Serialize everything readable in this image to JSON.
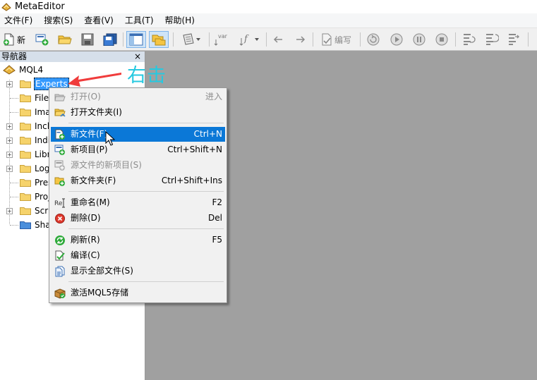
{
  "window": {
    "title": "MetaEditor"
  },
  "menubar": {
    "items": [
      {
        "label": "文件(F)"
      },
      {
        "label": "搜索(S)"
      },
      {
        "label": "查看(V)"
      },
      {
        "label": "工具(T)"
      },
      {
        "label": "帮助(H)"
      }
    ]
  },
  "toolbar": {
    "new_label": "新",
    "compile_label": "编写",
    "icons": [
      "new-file-icon",
      "new-project-icon",
      "open-folder-icon",
      "save-icon",
      "save-all-icon",
      "navigator-toggle-icon",
      "toolbox-toggle-icon",
      "styler-icon",
      "var-icon",
      "function-icon",
      "back-arrow-icon",
      "forward-arrow-icon",
      "compile-icon",
      "restart-icon",
      "play-icon",
      "pause-icon",
      "stop-icon",
      "step-into-icon",
      "step-over-icon",
      "step-out-icon"
    ]
  },
  "navigator": {
    "title": "导航器",
    "close": "×",
    "root": "MQL4",
    "items": [
      {
        "label": "Experts",
        "expandable": true,
        "selected": true
      },
      {
        "label": "Files",
        "expandable": false
      },
      {
        "label": "Images",
        "expandable": false
      },
      {
        "label": "Include",
        "expandable": true
      },
      {
        "label": "Indicators",
        "expandable": true
      },
      {
        "label": "Libraries",
        "expandable": true
      },
      {
        "label": "Logs",
        "expandable": true
      },
      {
        "label": "Presets",
        "expandable": false
      },
      {
        "label": "Projects",
        "expandable": false
      },
      {
        "label": "Scripts",
        "expandable": true
      },
      {
        "label": "Shared Projects",
        "expandable": false
      }
    ]
  },
  "annotation": {
    "text": "右击",
    "color": "#26c9e0",
    "arrow_color": "#f03c3c"
  },
  "context_menu": {
    "groups": [
      [
        {
          "label": "打开(O)",
          "shortcut": "进入",
          "disabled": true,
          "icon": "open-icon"
        },
        {
          "label": "打开文件夹(I)",
          "shortcut": "",
          "icon": "open-folder-icon"
        }
      ],
      [
        {
          "label": "新文件(F)",
          "shortcut": "Ctrl+N",
          "highlighted": true,
          "icon": "new-file-icon"
        },
        {
          "label": "新项目(P)",
          "shortcut": "Ctrl+Shift+N",
          "icon": "new-project-icon"
        },
        {
          "label": "源文件的新项目(S)",
          "shortcut": "",
          "disabled": true,
          "icon": "new-project-from-source-icon"
        },
        {
          "label": "新文件夹(F)",
          "shortcut": "Ctrl+Shift+Ins",
          "icon": "new-folder-icon"
        }
      ],
      [
        {
          "label": "重命名(M)",
          "shortcut": "F2",
          "icon": "rename-icon"
        },
        {
          "label": "删除(D)",
          "shortcut": "Del",
          "icon": "delete-icon"
        }
      ],
      [
        {
          "label": "刷新(R)",
          "shortcut": "F5",
          "icon": "refresh-icon"
        },
        {
          "label": "编译(C)",
          "shortcut": "",
          "icon": "compile-icon"
        },
        {
          "label": "显示全部文件(S)",
          "shortcut": "",
          "icon": "show-all-files-icon"
        }
      ],
      [
        {
          "label": "激活MQL5存储",
          "shortcut": "",
          "icon": "activate-storage-icon"
        }
      ]
    ]
  },
  "colors": {
    "highlight": "#0b78d7",
    "selection": "#3399ff",
    "workspace": "#a0a0a0",
    "panel_header": "#d6dfea"
  }
}
